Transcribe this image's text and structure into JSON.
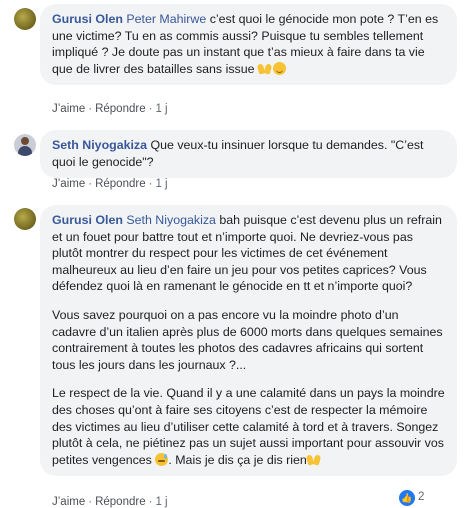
{
  "comments": [
    {
      "author": "Gurusi Olen",
      "mention": "Peter Mahirwe",
      "text": "c’est quoi le génocide mon pote ? T’en es une victime? Tu en as commis aussi? Puisque tu sembles tellement impliqué ? Je doute pas un instant que t’as mieux à faire dans ta vie que de livrer des batailles sans issue",
      "emojis": [
        "raising-hands",
        "smile"
      ],
      "like_label": "J’aime",
      "reply_label": "Répondre",
      "time": "1 j"
    },
    {
      "author": "Seth Niyogakiza",
      "text": "Que veux-tu insinuer lorsque tu demandes. \"C’est quoi le genocide\"?",
      "like_label": "J’aime",
      "reply_label": "Répondre",
      "time": "1 j"
    },
    {
      "author": "Gurusi Olen",
      "mention": "Seth Niyogakiza",
      "paragraphs": [
        "bah puisque c’est devenu plus un refrain et un fouet pour battre tout et n’importe quoi. Ne devriez-vous pas plutôt montrer du respect pour les victimes de cet événement malheureux au lieu d’en faire un jeu pour vos petites caprices? Vous défendez quoi là en ramenant le génocide en tt et n’importe quoi?",
        "Vous savez pourquoi on a pas encore vu la moindre photo d’un cadavre d’un italien après plus de 6000 morts dans quelques semaines contrairement à toutes les photos des cadavres africains qui sortent tous les jours dans les journaux ?...",
        "Le respect de la vie. Quand il y a une calamité dans un pays la moindre des choses qu’ont à faire ses citoyens c’est de respecter la mémoire des victimes au lieu d’utiliser cette calamité à tord et à travers. Songez plutôt à cela, ne piétinez pas un sujet aussi important pour assouvir vos petites vengences",
        ". Mais je dis ça je dis rien"
      ],
      "emojis": [
        "sweat-smile",
        "raising-hands"
      ],
      "like_label": "J’aime",
      "reply_label": "Répondre",
      "time": "1 j",
      "reaction_count": "2"
    }
  ],
  "colors": {
    "name": "#385898",
    "bubble": "#f2f3f5",
    "meta": "#606770",
    "like": "#2078f4"
  }
}
